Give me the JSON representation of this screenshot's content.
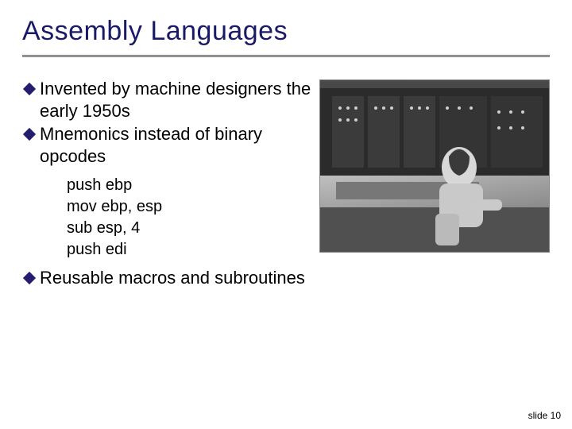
{
  "title": "Assembly Languages",
  "bullets": [
    {
      "text": "Invented by machine designers the early 1950s"
    },
    {
      "text": "Mnemonics instead of binary opcodes"
    },
    {
      "text": "Reusable macros and subroutines"
    }
  ],
  "code": {
    "line1": "push ebp",
    "line2": "mov ebp, esp",
    "line3": "sub esp, 4",
    "line4": "push edi"
  },
  "image": {
    "alt": "Black-and-white photograph of an early computer operator at a machine console, circa 1950s"
  },
  "footer": "slide 10",
  "colors": {
    "title": "#1a1a66",
    "bullet": "#241c6e"
  }
}
